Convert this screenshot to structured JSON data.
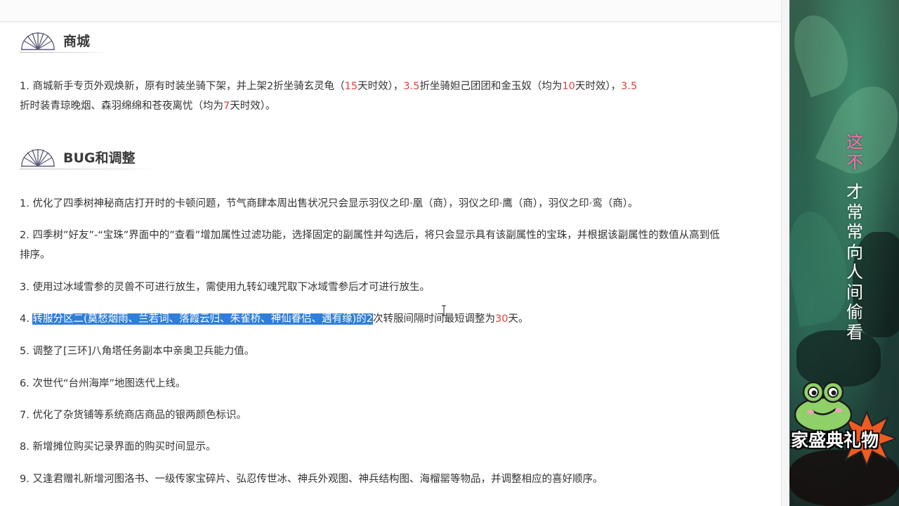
{
  "sections": {
    "mall": {
      "title": "商城"
    },
    "bug": {
      "title": "BUG和调整"
    }
  },
  "mall_item": {
    "p1": "1. 商城新手专页外观焕新，原有时装坐骑下架，并上架2折坐骑玄灵龟（",
    "r1": "15",
    "p2": "天时效），",
    "r2": "3.5",
    "p3": "折坐骑妲己团团和金玉奴（均为",
    "r3": "10",
    "p4": "天时效），",
    "r4": "3.5",
    "p5": "折时装青琼晚烟、森羽绵绵和苍夜离忧（均为",
    "r5": "7",
    "p6": "天时效）。"
  },
  "bug_items": {
    "i1": "1. 优化了四季树神秘商店打开时的卡顿问题，节气商肆本周出售状况只会显示羽仪之印·凰（商），羽仪之印·鹰（商），羽仪之印·鸾（商）。",
    "i2": "2. 四季树”好友”-“宝珠”界面中的”查看”增加属性过滤功能，选择固定的副属性并勾选后，将只会显示具有该副属性的宝珠，并根据该副属性的数值从高到低排序。",
    "i3": "3. 使用过冰域雪参的灵兽不可进行放生，需使用九转幻魂咒取下冰域雪参后才可进行放生。",
    "i4_prefix": "4. ",
    "i4_selected": "转服分区二(莫愁烟雨、兰若词、落霞云归、朱雀桥、神仙眷侣、遇有缘)的2",
    "i4_mid": "次转服间隔时间最短调整为",
    "i4_red": "30",
    "i4_end": "天。",
    "i5": "5. 调整了[三环]八角塔任务副本中亲奥卫兵能力值。",
    "i6": "6. 次世代“台州海岸”地图迭代上线。",
    "i7": "7. 优化了杂货铺等系统商店商品的银两颜色标识。",
    "i8": "8. 新增摊位购买记录界面的购买时间显示。",
    "i9": "9. 又逢君赠礼新增河图洛书、一级传家宝碎片、弘忍传世冰、神兵外观图、神兵结构图、海榴罂等物品，并调整相应的喜好顺序。"
  },
  "side_panel": {
    "caption_pink": "这不",
    "caption_white": "才常常向人间偷看",
    "banner": "家盛典礼物"
  },
  "colors": {
    "accent_red": "#e0413a",
    "selection": "#2f7fd8",
    "caption_pink": "#ff6fb0"
  },
  "icons": [
    "fan-icon",
    "text-cursor-icon",
    "frog-sticker-icon"
  ]
}
